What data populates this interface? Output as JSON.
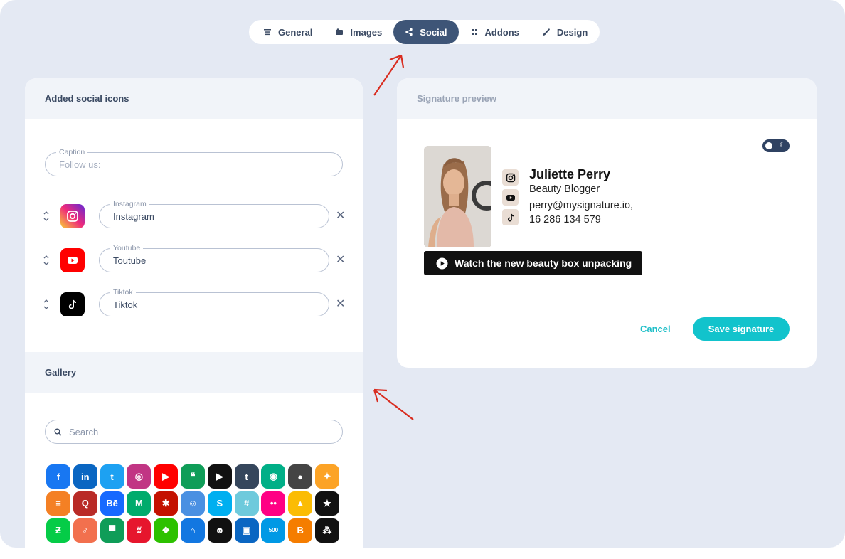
{
  "tabs": [
    {
      "label": "General",
      "icon": "lines-icon",
      "active": false
    },
    {
      "label": "Images",
      "icon": "image-icon",
      "active": false
    },
    {
      "label": "Social",
      "icon": "share-icon",
      "active": true
    },
    {
      "label": "Addons",
      "icon": "grid-icon",
      "active": false
    },
    {
      "label": "Design",
      "icon": "brush-icon",
      "active": false
    }
  ],
  "left_panel": {
    "title": "Added social icons",
    "caption": {
      "label": "Caption",
      "placeholder": "Follow us:"
    },
    "socials": [
      {
        "label": "Instagram",
        "value": "Instagram",
        "icon": "instagram-icon"
      },
      {
        "label": "Youtube",
        "value": "Toutube",
        "icon": "youtube-icon"
      },
      {
        "label": "Tiktok",
        "value": "Tiktok",
        "icon": "tiktok-icon"
      }
    ],
    "remove_glyph": "✕"
  },
  "gallery": {
    "title": "Gallery",
    "search_placeholder": "Search",
    "icons": [
      {
        "name": "facebook-icon",
        "color": "#1877f2",
        "glyph": "f"
      },
      {
        "name": "linkedin-icon",
        "color": "#0a66c2",
        "glyph": "in"
      },
      {
        "name": "twitter-icon",
        "color": "#1da1f2",
        "glyph": "t"
      },
      {
        "name": "instagram-icon",
        "color": "#c13584",
        "glyph": "◎"
      },
      {
        "name": "youtube-icon",
        "color": "#ff0000",
        "glyph": "▶"
      },
      {
        "name": "hangouts-icon",
        "color": "#0f9d58",
        "glyph": "❝"
      },
      {
        "name": "google-play-icon",
        "color": "#111111",
        "glyph": "▶"
      },
      {
        "name": "tumblr-icon",
        "color": "#35465c",
        "glyph": "t"
      },
      {
        "name": "tripadvisor-icon",
        "color": "#00af87",
        "glyph": "◉"
      },
      {
        "name": "github-icon",
        "color": "#444444",
        "glyph": "●"
      },
      {
        "name": "gitlab-icon",
        "color": "#fca326",
        "glyph": "✦"
      },
      {
        "name": "stackoverflow-icon",
        "color": "#f48024",
        "glyph": "≡"
      },
      {
        "name": "quora-icon",
        "color": "#b92b27",
        "glyph": "Q"
      },
      {
        "name": "behance-icon",
        "color": "#1769ff",
        "glyph": "Bē"
      },
      {
        "name": "medium-icon",
        "color": "#00ab6c",
        "glyph": "M"
      },
      {
        "name": "yelp-icon",
        "color": "#c41200",
        "glyph": "✱"
      },
      {
        "name": "snapchat-icon",
        "color": "#4a90e2",
        "glyph": "☺"
      },
      {
        "name": "skype-icon",
        "color": "#00aff0",
        "glyph": "S"
      },
      {
        "name": "slack-icon",
        "color": "#6ecadc",
        "glyph": "#"
      },
      {
        "name": "flickr-icon",
        "color": "#ff0084",
        "glyph": "••"
      },
      {
        "name": "google-drive-icon",
        "color": "#fbbc04",
        "glyph": "▲"
      },
      {
        "name": "star-icon",
        "color": "#111111",
        "glyph": "★"
      },
      {
        "name": "deviantart-icon",
        "color": "#05cc47",
        "glyph": "Ƶ"
      },
      {
        "name": "badoo-icon",
        "color": "#f2704e",
        "glyph": "♂"
      },
      {
        "name": "shirt-icon",
        "color": "#0f9d58",
        "glyph": "▀"
      },
      {
        "name": "weibo-icon",
        "color": "#e6162d",
        "glyph": "ʬ"
      },
      {
        "name": "wechat-icon",
        "color": "#2dc100",
        "glyph": "❖"
      },
      {
        "name": "zillow-icon",
        "color": "#1277e1",
        "glyph": "⌂"
      },
      {
        "name": "smile-icon",
        "color": "#111111",
        "glyph": "☻"
      },
      {
        "name": "box-icon",
        "color": "#0a66c2",
        "glyph": "▣"
      },
      {
        "name": "500px-icon",
        "color": "#0099e5",
        "glyph": "500"
      },
      {
        "name": "blogger-icon",
        "color": "#f57d00",
        "glyph": "B"
      },
      {
        "name": "meetup-icon",
        "color": "#111111",
        "glyph": "⁂"
      }
    ]
  },
  "preview": {
    "title": "Signature preview",
    "name": "Juliette Perry",
    "role": "Beauty Blogger",
    "email": "perry@mysignature.io,",
    "phone": "16 286 134 579",
    "banner": "Watch the new beauty box unpacking",
    "cancel_label": "Cancel",
    "save_label": "Save signature",
    "accent": "#12c3cc"
  }
}
